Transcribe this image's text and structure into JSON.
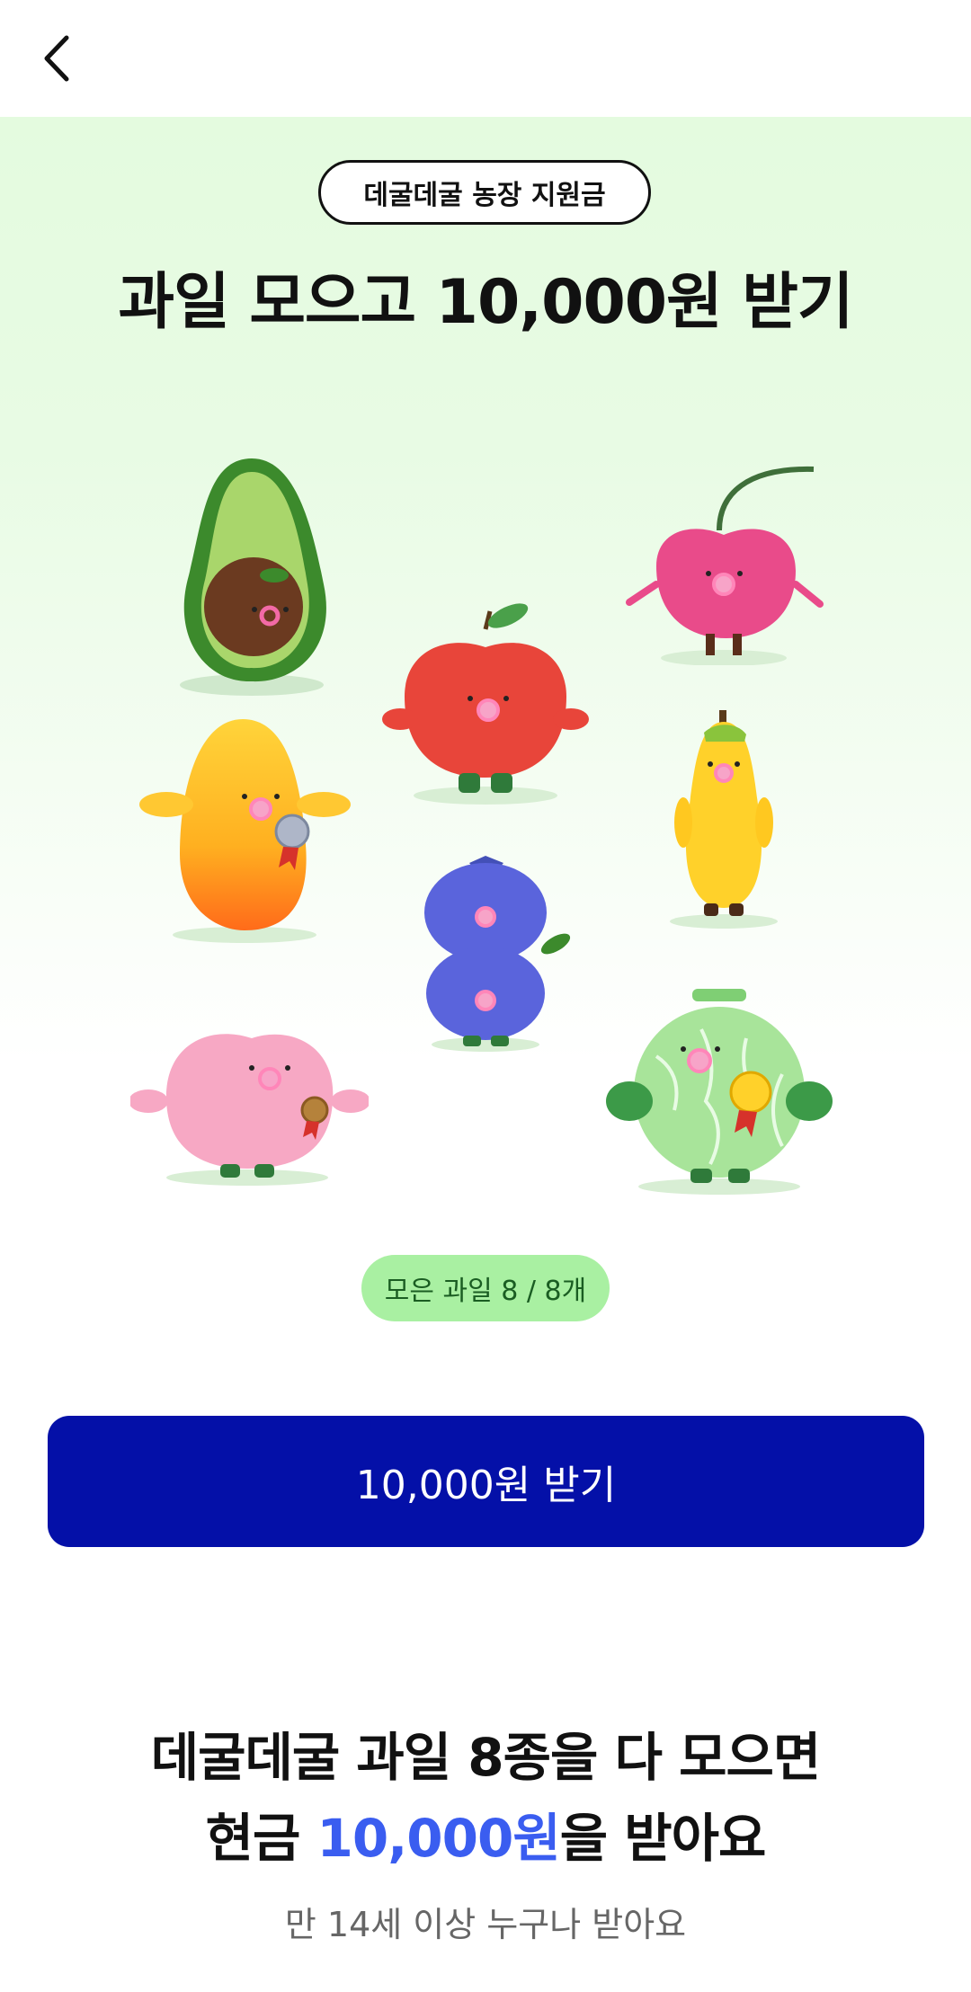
{
  "header": {
    "back_icon": "chevron-left-icon"
  },
  "hero": {
    "badge": "데굴데굴 농장 지원금",
    "title": "과일 모으고 10,000원 받기",
    "fruits": [
      "avocado",
      "cherry",
      "apple",
      "mango",
      "pear",
      "blueberry",
      "peach",
      "melon"
    ]
  },
  "progress": {
    "label": "모은 과일 8 / 8개",
    "collected": 8,
    "total": 8
  },
  "cta": {
    "label": "10,000원 받기"
  },
  "info": {
    "line1": "데굴데굴 과일 8종을 다 모으면",
    "line2_prefix": "현금 ",
    "line2_amount": "10,000원",
    "line2_suffix": "을 받아요",
    "note": "만 14세 이상 누구나 받아요"
  },
  "colors": {
    "primary_button": "#0410a8",
    "accent_text": "#3a5df0",
    "progress_badge_bg": "#a9f0a2",
    "hero_bg": "#e4fbdf"
  }
}
